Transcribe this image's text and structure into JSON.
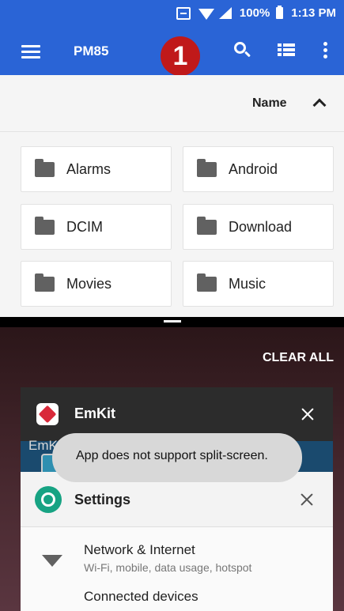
{
  "status_bar": {
    "battery": "100%",
    "time": "1:13 PM"
  },
  "toolbar": {
    "title": "PM85",
    "badge": "1"
  },
  "sort": {
    "label": "Name"
  },
  "folders": [
    "Alarms",
    "Android",
    "DCIM",
    "Download",
    "Movies",
    "Music"
  ],
  "recents": {
    "clear_all": "CLEAR ALL",
    "emkit": {
      "title": "EmKit",
      "subtitle": "EmKit Secure"
    },
    "toast": "App does not support split-screen.",
    "settings": {
      "title": "Settings",
      "row_title": "Network & Internet",
      "row_subtitle": "Wi-Fi, mobile, data usage, hotspot",
      "next_row_title": "Connected devices"
    }
  },
  "colors": {
    "toolbar": "#2a64d6",
    "badge": "#c0191a",
    "settings_icon": "#17a383",
    "emkit_icon": "#d9293a"
  },
  "icons": [
    "scan-icon",
    "wifi-icon",
    "signal-icon",
    "battery-icon",
    "menu-icon",
    "search-icon",
    "list-view-icon",
    "overflow-icon",
    "sort-arrow-icon",
    "folder-icon",
    "close-icon"
  ]
}
